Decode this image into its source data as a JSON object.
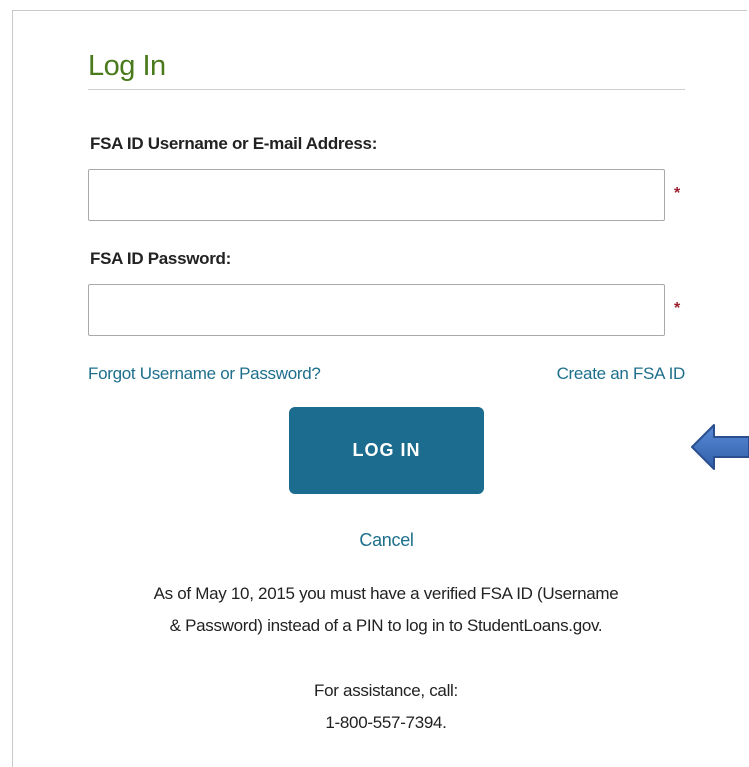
{
  "login": {
    "title": "Log In",
    "username_label": "FSA ID Username or E-mail Address:",
    "username_value": "",
    "password_label": "FSA ID Password:",
    "password_value": "",
    "required_marker": "*",
    "forgot_link": "Forgot Username or Password?",
    "create_link": "Create an FSA ID",
    "login_button": "LOG IN",
    "cancel_link": "Cancel",
    "notice_line1": "As of May 10, 2015 you must have a verified FSA ID (Username",
    "notice_line2": "& Password) instead of a PIN to log in to StudentLoans.gov.",
    "assist_line1": "For assistance, call:",
    "assist_line2": "1-800-557-7394."
  },
  "icons": {
    "pointer_arrow": "arrow-left-icon"
  },
  "colors": {
    "title": "#4a7a1c",
    "link": "#1d6f8c",
    "button": "#1b6c8e",
    "required": "#9b1f2e",
    "arrow": "#4472c4"
  }
}
